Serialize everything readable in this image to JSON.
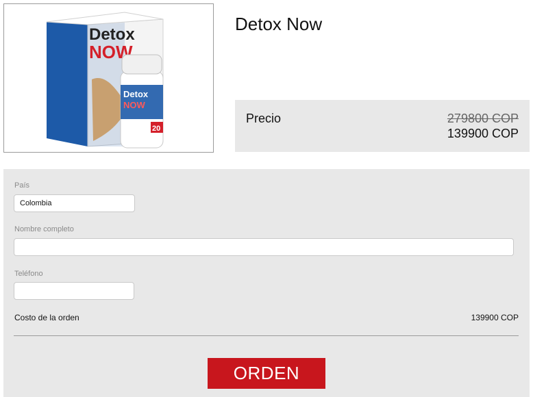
{
  "product": {
    "title": "Detox Now",
    "image_alt": "Detox Now package and bottle",
    "package_text": {
      "brand_top": "Detox",
      "brand_bottom": "NOW",
      "bottle_brand_top": "Detox",
      "bottle_brand_bottom": "NOW",
      "bottle_count": "20"
    }
  },
  "pricing": {
    "label": "Precio",
    "old_price": "279800 COP",
    "new_price": "139900 COP"
  },
  "form": {
    "country": {
      "label": "País",
      "value": "Colombia"
    },
    "full_name": {
      "label": "Nombre completo",
      "value": "",
      "placeholder": ""
    },
    "phone": {
      "label": "Teléfono",
      "value": "",
      "placeholder": ""
    },
    "total": {
      "label": "Costo de la orden",
      "value": "139900 COP"
    },
    "submit_label": "ORDEN"
  },
  "colors": {
    "accent_red": "#c8161d",
    "panel_gray": "#e8e8e8",
    "box_blue": "#1d5aa8"
  }
}
